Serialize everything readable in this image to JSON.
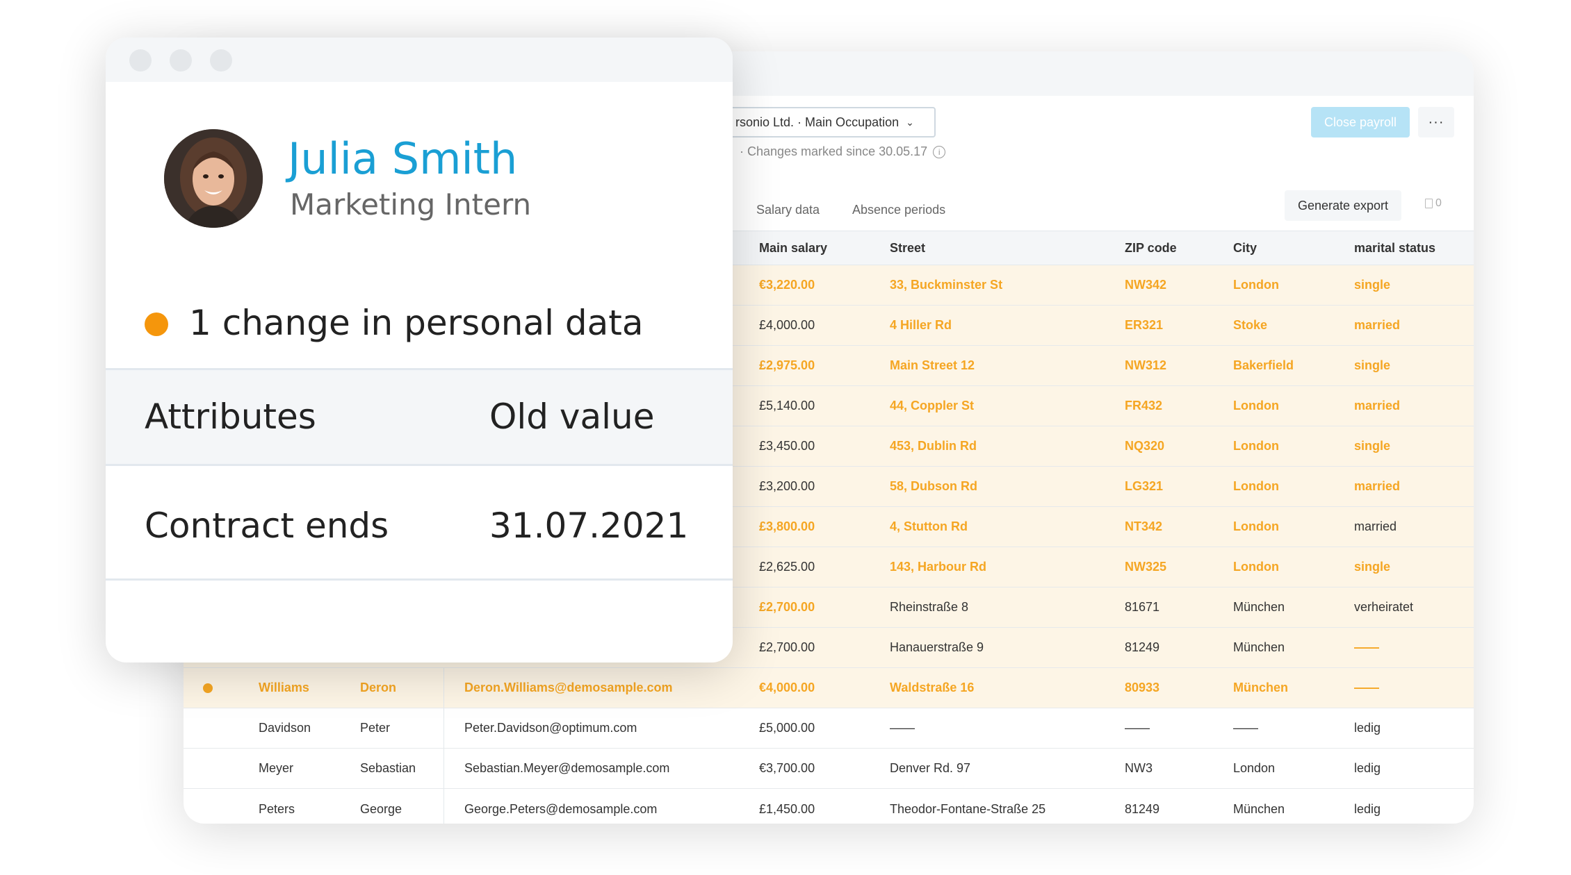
{
  "payroll": {
    "company_select": "rsonio Ltd. · Main Occupation",
    "changes_note": "· Changes marked since 30.05.17",
    "close_payroll_label": "Close payroll",
    "more_label": "···",
    "tabs": [
      {
        "label": "Salary data"
      },
      {
        "label": "Absence periods"
      }
    ],
    "generate_export_label": "Generate export",
    "export_count": "0",
    "columns": {
      "main_salary": "Main salary",
      "street": "Street",
      "zip": "ZIP code",
      "city": "City",
      "marital": "marital status"
    },
    "rows": [
      {
        "salary": "€3,220.00",
        "street": "33, Buckminster St",
        "zip": "NW342",
        "city": "London",
        "marital": "single"
      },
      {
        "salary": "£4,000.00",
        "street": "4 Hiller Rd",
        "zip": "ER321",
        "city": "Stoke",
        "marital": "married"
      },
      {
        "salary": "£2,975.00",
        "street": "Main Street 12",
        "zip": "NW312",
        "city": "Bakerfield",
        "marital": "single"
      },
      {
        "salary": "£5,140.00",
        "street": "44, Coppler St",
        "zip": "FR432",
        "city": "London",
        "marital": "married"
      },
      {
        "salary": "£3,450.00",
        "street": "453, Dublin Rd",
        "zip": "NQ320",
        "city": "London",
        "marital": "single"
      },
      {
        "salary": "£3,200.00",
        "street": "58, Dubson Rd",
        "zip": "LG321",
        "city": "London",
        "marital": "married"
      },
      {
        "salary": "£3,800.00",
        "street": "4, Stutton Rd",
        "zip": "NT342",
        "city": "London",
        "marital": "married"
      },
      {
        "salary": "£2,625.00",
        "street": "143, Harbour Rd",
        "zip": "NW325",
        "city": "London",
        "marital": "single"
      },
      {
        "salary": "£2,700.00",
        "street": "Rheinstraße 8",
        "zip": "81671",
        "city": "München",
        "marital": "verheiratet"
      },
      {
        "salary": "£2,700.00",
        "street": "Hanauerstraße 9",
        "zip": "81249",
        "city": "München",
        "marital": "——"
      },
      {
        "last": "Williams",
        "first": "Deron",
        "email": "Deron.Williams@demosample.com",
        "salary": "€4,000.00",
        "street": "Waldstraße 16",
        "zip": "80933",
        "city": "München",
        "marital": "——"
      },
      {
        "last": "Davidson",
        "first": "Peter",
        "email": "Peter.Davidson@optimum.com",
        "salary": "£5,000.00",
        "street": "——",
        "zip": "——",
        "city": "——",
        "marital": "ledig"
      },
      {
        "last": "Meyer",
        "first": "Sebastian",
        "email": "Sebastian.Meyer@demosample.com",
        "salary": "€3,700.00",
        "street": "Denver Rd. 97",
        "zip": "NW3",
        "city": "London",
        "marital": "ledig"
      },
      {
        "last": "Peters",
        "first": "George",
        "email": "George.Peters@demosample.com",
        "salary": "£1,450.00",
        "street": "Theodor-Fontane-Straße 25",
        "zip": "81249",
        "city": "München",
        "marital": "ledig"
      }
    ]
  },
  "card": {
    "name": "Julia Smith",
    "role": "Marketing Intern",
    "change_summary": "1 change in personal data",
    "header_attributes": "Attributes",
    "header_old_value": "Old value",
    "attr_name": "Contract ends",
    "attr_old_value": "31.07.2021"
  },
  "colors": {
    "accent_blue": "#1a9fd4",
    "change_orange": "#f5a623",
    "row_highlight": "#fdf5e6"
  }
}
